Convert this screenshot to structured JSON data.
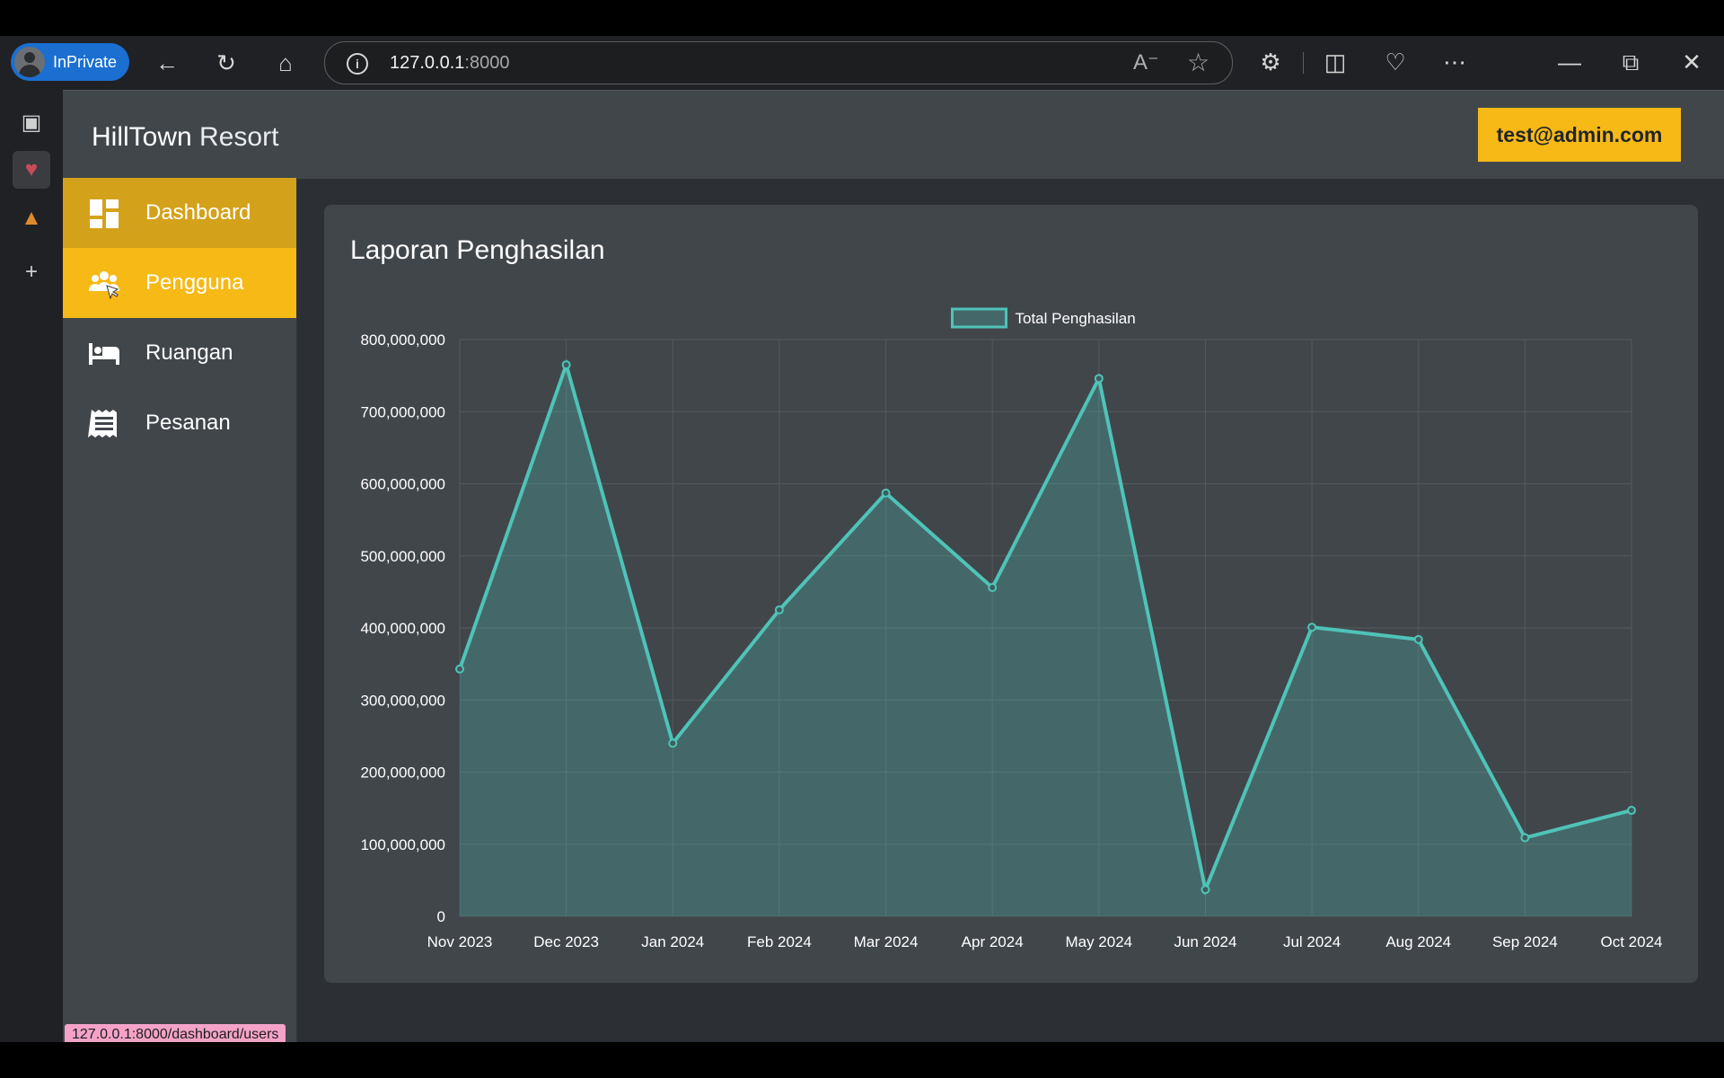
{
  "browser": {
    "inprivate_label": "InPrivate",
    "url_host": "127.0.0.1",
    "url_port": ":8000",
    "status_url": "127.0.0.1:8000/dashboard/users"
  },
  "app": {
    "brand_bold": "HillTown",
    "brand_light": " Resort",
    "user_email": "test@admin.com"
  },
  "sidebar": {
    "items": [
      {
        "label": "Dashboard",
        "icon": "dashboard-icon"
      },
      {
        "label": "Pengguna",
        "icon": "users-icon"
      },
      {
        "label": "Ruangan",
        "icon": "bed-icon"
      },
      {
        "label": "Pesanan",
        "icon": "receipt-icon"
      }
    ]
  },
  "main": {
    "card_title": "Laporan Penghasilan"
  },
  "colors": {
    "accent": "#f7b916",
    "accent_dark": "#d4a11a",
    "line": "#4fc3b8"
  },
  "chart_data": {
    "type": "area",
    "categories": [
      "Nov 2023",
      "Dec 2023",
      "Jan 2024",
      "Feb 2024",
      "Mar 2024",
      "Apr 2024",
      "May 2024",
      "Jun 2024",
      "Jul 2024",
      "Aug 2024",
      "Sep 2024",
      "Oct 2024"
    ],
    "series": [
      {
        "name": "Total Penghasilan",
        "values": [
          343000000,
          765000000,
          240000000,
          425000000,
          587000000,
          456000000,
          746000000,
          37000000,
          401000000,
          384000000,
          109000000,
          147000000
        ]
      }
    ],
    "yticks": [
      "0",
      "100,000,000",
      "200,000,000",
      "300,000,000",
      "400,000,000",
      "500,000,000",
      "600,000,000",
      "700,000,000",
      "800,000,000"
    ],
    "ylim": [
      0,
      800000000
    ],
    "grid": true,
    "legend": "top-center"
  }
}
